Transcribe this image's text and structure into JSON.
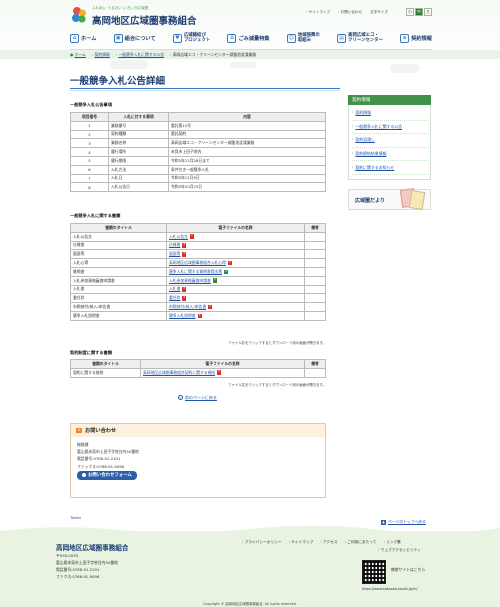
{
  "header": {
    "tagline": "ふれあい うるおい いきいき広域圏",
    "site_title": "高岡地区広域圏事務組合",
    "util": {
      "sitemap": "サイトマップ",
      "inquiry": "お問い合わせ",
      "text_size": "文字サイズ",
      "size_small": "小",
      "size_mid": "中",
      "size_large": "大"
    }
  },
  "nav": [
    {
      "label": "ホーム",
      "icon": "home-icon"
    },
    {
      "label": "組合について",
      "icon": "building-icon"
    },
    {
      "label": "広域縁結び\nプロジェクト",
      "icon": "heart-icon"
    },
    {
      "label": "ごみ減量特集",
      "icon": "recycle-icon"
    },
    {
      "label": "地域振興の\n取組み",
      "icon": "community-icon"
    },
    {
      "label": "高岡広域エコ・\nクリーンセンター",
      "icon": "factory-icon"
    },
    {
      "label": "契約情報",
      "icon": "document-icon"
    }
  ],
  "breadcrumb": [
    "ホーム",
    "契約情報",
    "一般競争入札に関する公告",
    "高岡広域エコ・クリーンセンター調整池浚渫業務"
  ],
  "page_title": "一般競争入札公告詳細",
  "section1": {
    "title": "一般競争入札公告事項",
    "headers": [
      "項目番号",
      "入札に付する事項",
      "内容"
    ],
    "rows": [
      [
        "1",
        "業務番号",
        "委託第15号"
      ],
      [
        "2",
        "契約種類",
        "委託契約"
      ],
      [
        "3",
        "業務名称",
        "高岡広域エコ・クリーンセンター調整池浚渫業務"
      ],
      [
        "4",
        "履行場所",
        "氷見市上田子地内"
      ],
      [
        "5",
        "履行期限",
        "令和5年12月28日まで"
      ],
      [
        "6",
        "入札方法",
        "条件付き一般競争入札"
      ],
      [
        "7",
        "入札日",
        "令和5年11月9日"
      ],
      [
        "8",
        "入札公告日",
        "令和5年10月25日"
      ]
    ]
  },
  "section2": {
    "title": "一般競争入札に関する書類",
    "headers": [
      "書類のタイトル",
      "電子ファイルの名称",
      "備考"
    ],
    "rows": [
      {
        "title": "入札公告文",
        "file": "入札公告文",
        "type": "pdf"
      },
      {
        "title": "仕様書",
        "file": "仕様書",
        "type": "pdf"
      },
      {
        "title": "図面等",
        "file": "図面等",
        "type": "pdf"
      },
      {
        "title": "入札心得",
        "file": "高岡地区広域圏事務組合入札心得",
        "type": "pdf"
      },
      {
        "title": "質問書",
        "file": "競争入札に関する質問書提出票",
        "type": "xls"
      },
      {
        "title": "入札参加資格審査申請書",
        "file": "入札参加資格審査申請書",
        "type": "xls"
      },
      {
        "title": "入札書",
        "file": "入札書",
        "type": "pdf"
      },
      {
        "title": "委任状",
        "file": "委任状",
        "type": "pdf"
      },
      {
        "title": "市税納付(納入)申告書",
        "file": "市税納付(納入)申告書",
        "type": "pdf"
      },
      {
        "title": "競争入札説明書",
        "file": "競争入札説明書",
        "type": "pdf"
      }
    ],
    "note": "ファイル名をクリックするとダウンロード用の画面が開きます。"
  },
  "section3": {
    "title": "契約制度に関する書類",
    "headers": [
      "書類のタイトル",
      "電子ファイルの名称",
      "備考"
    ],
    "rows": [
      {
        "title": "契約に関する規則",
        "file": "高岡地区広域圏事務組合契約に関する規則",
        "type": "pdf"
      }
    ],
    "note": "ファイル名をクリックするとダウンロード用の画面が開きます。"
  },
  "back_link": "前のページに戻る",
  "contact": {
    "heading": "お問い合わせ",
    "dept": "総務課",
    "address": "富山県氷見市上田子字笹谷内50番地",
    "tel": "電話番号:0766-91-2101",
    "fax": "ファックス:0766-91-9098",
    "button": "お問い合わせフォーム"
  },
  "tweet": "Tweet",
  "pagetop": "ページのトップへ戻る",
  "sidebar": {
    "heading": "契約情報",
    "links": [
      "契約情報",
      "一般競争入札に関する公告",
      "契約見通し",
      "契約締結結果情報",
      "契約に関するお知らせ"
    ],
    "kouhou": "広域圏だより"
  },
  "footer": {
    "name": "高岡地区広域圏事務組合",
    "zip": "〒935-0035",
    "address": "富山県氷見市上田子字笹谷内50番地",
    "tel": "電話番号:0766-91-2101",
    "fax": "ファクス:0766-91-9098",
    "links": [
      "プライバシーポリシー",
      "サイトマップ",
      "アクセス",
      "ご利用にあたって",
      "リンク集"
    ],
    "a11y": "ウェブアクセシビリティ",
    "qr_label": "携帯サイトはこちら",
    "qr_url": "https://www.takaoka-kouiki.jp/m/",
    "copyright": "Copyright © 高岡地区広域圏事務組合. All rights reserved."
  }
}
